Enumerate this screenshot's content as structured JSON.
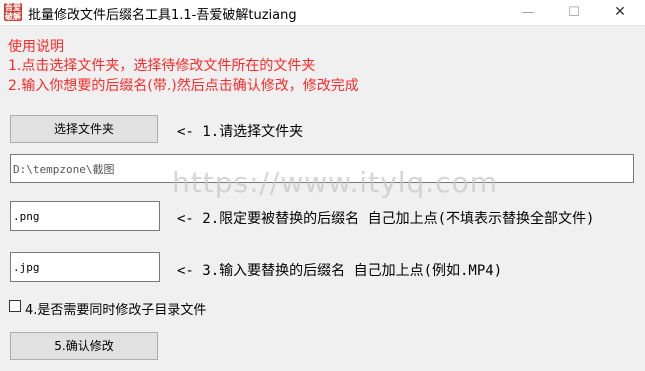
{
  "window": {
    "title": "批量修改文件后缀名工具1.1-吾爱破解tuziang",
    "icon_text": "吾爱\n破解",
    "minimize_icon": "—",
    "maximize_icon": "☐",
    "close_icon": "✕"
  },
  "instructions": {
    "heading": "使用说明",
    "line1": "1.点击选择文件夹，选择待修改文件所在的文件夹",
    "line2": "2.输入你想要的后缀名(带.)然后点击确认修改，修改完成"
  },
  "step1": {
    "button_label": "选择文件夹",
    "hint": "<- 1.请选择文件夹",
    "path_value": "D:\\tempzone\\截图"
  },
  "step2": {
    "value": ".png",
    "hint": "<- 2.限定要被替换的后缀名 自己加上点(不填表示替换全部文件)"
  },
  "step3": {
    "value": ".jpg",
    "hint": "<- 3.输入要替换的后缀名 自己加上点(例如.MP4)"
  },
  "step4": {
    "checkbox_label": "4.是否需要同时修改子目录文件",
    "checked": false
  },
  "step5": {
    "button_label": "5.确认修改"
  },
  "watermark": "https://www.itylq.com",
  "colors": {
    "instruction_text": "#ff2a2a",
    "client_bg": "#f0f0f0"
  }
}
